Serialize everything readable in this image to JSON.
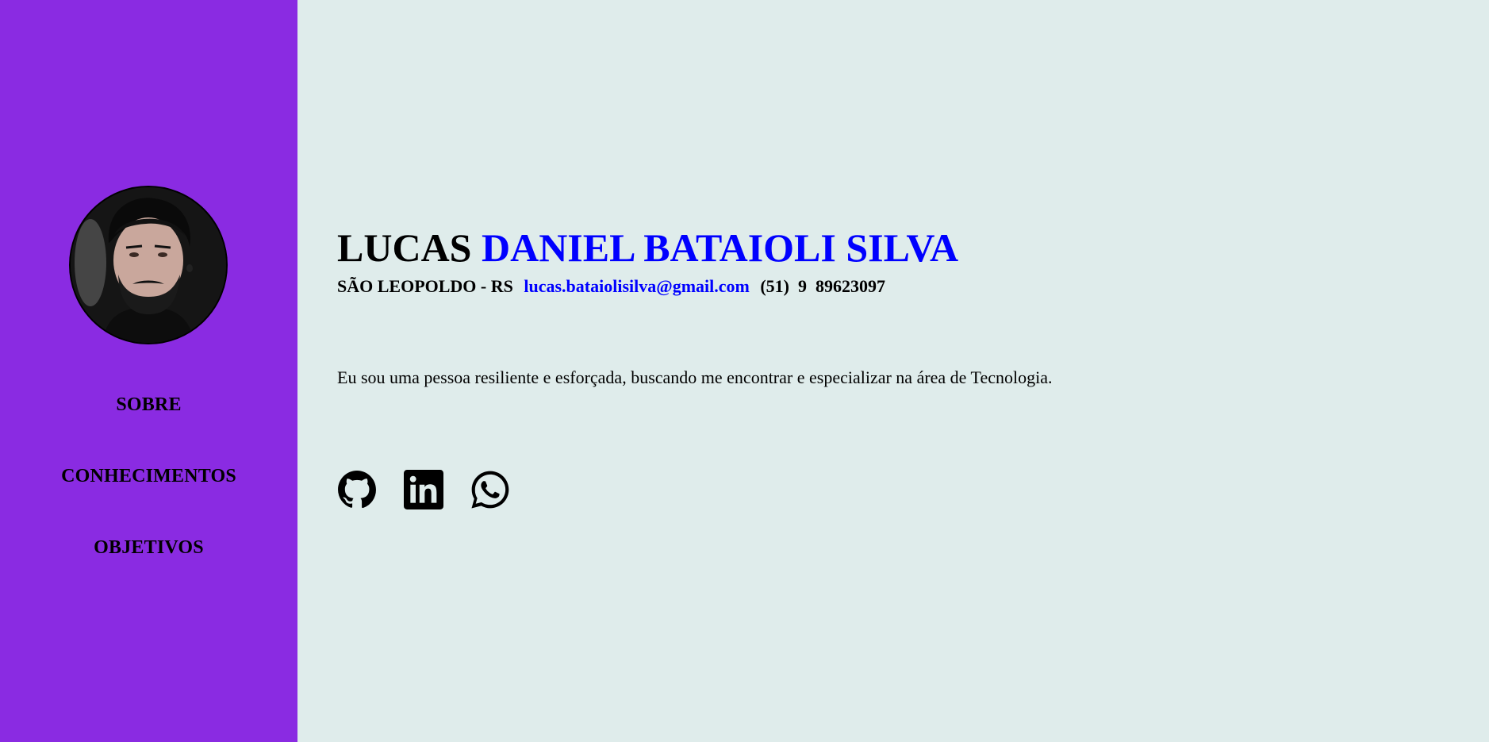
{
  "sidebar": {
    "avatar_alt": "Lucas",
    "nav": [
      {
        "label": "SOBRE"
      },
      {
        "label": "CONHECIMENTOS"
      },
      {
        "label": "OBJETIVOS"
      }
    ]
  },
  "header": {
    "first_name": "LUCAS",
    "last_name": "DANIEL BATAIOLI SILVA",
    "location": "SÃO LEOPOLDO - RS",
    "email": "lucas.bataiolisilva@gmail.com",
    "phone": "(51)  9  89623097"
  },
  "main": {
    "bio": "Eu sou uma pessoa resiliente e esforçada, buscando me encontrar e especializar na área de Tecnologia."
  },
  "socials": [
    {
      "icon": "github-icon"
    },
    {
      "icon": "linkedin-icon"
    },
    {
      "icon": "whatsapp-icon"
    }
  ],
  "colors": {
    "sidebar_bg": "#8a2be2",
    "main_bg": "#dfeceb",
    "accent": "#0000ff",
    "text": "#000000"
  }
}
